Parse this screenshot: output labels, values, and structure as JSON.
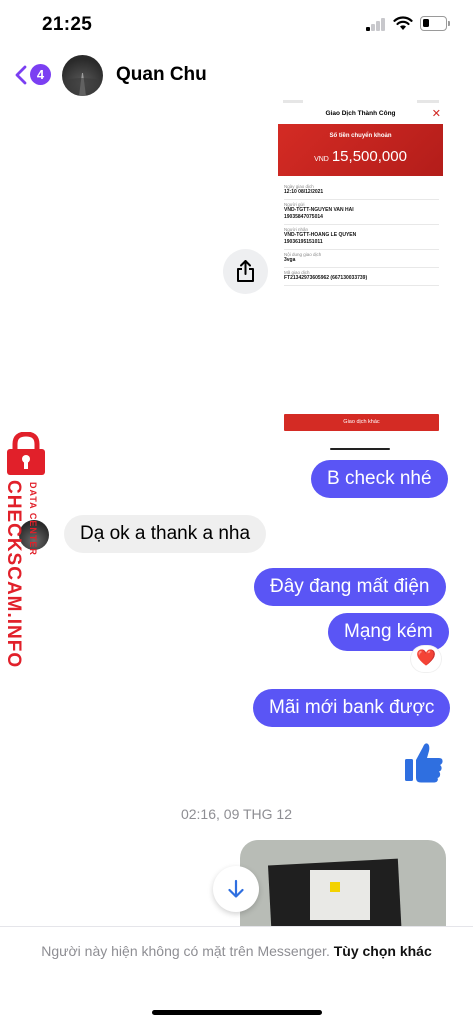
{
  "status_bar": {
    "time": "21:25"
  },
  "header": {
    "unread_count": "4",
    "contact_name": "Quan Chu"
  },
  "shared_image": {
    "title": "Giao Dịch Thành Công",
    "amount_label": "Số tiền chuyển khoản",
    "currency": "VND",
    "amount": "15,500,000",
    "fields": [
      {
        "label": "Ngày giao dịch",
        "value": "12:10 08/12/2021"
      },
      {
        "label": "Người gửi",
        "value": "VND-TGTT-NGUYEN VAN HAI\n19035847075014"
      },
      {
        "label": "Người nhận",
        "value": "VND-TGTT-HOANG LE QUYEN\n19036195151011"
      },
      {
        "label": "Nội dung giao dịch",
        "value": "3vga"
      },
      {
        "label": "Mã giao dịch",
        "value": "FT21342973605962 (667130033739)"
      }
    ],
    "button_label": "Giao dịch khác"
  },
  "messages": [
    {
      "direction": "out",
      "text": "B check nhé"
    },
    {
      "direction": "in",
      "text": "Dạ ok a thank a nha"
    },
    {
      "direction": "out",
      "text": "Đây đang mất điện"
    },
    {
      "direction": "out",
      "text": "Mạng kém"
    },
    {
      "direction": "out",
      "text": "Mãi mới bank được"
    }
  ],
  "reaction": "❤️",
  "timestamp": "02:16, 09 THG 12",
  "footer": {
    "notice": "Người này hiện không có mặt trên Messenger.",
    "link": "Tùy chọn khác"
  },
  "watermark": {
    "main": "CHECKSCAM.INFO",
    "sub": "DATA CENTER"
  },
  "colors": {
    "bubble_out": "#5a55f5",
    "bubble_in": "#efefef",
    "badge": "#7b3ff2",
    "bank_red": "#d42b24",
    "like": "#2f6fe0"
  }
}
